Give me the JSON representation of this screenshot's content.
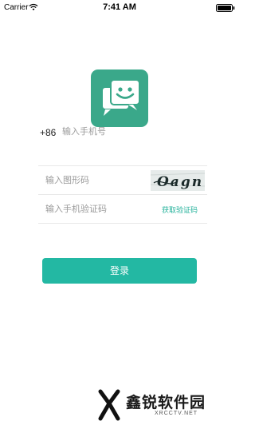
{
  "status_bar": {
    "carrier": "Carrier",
    "time": "7:41 AM",
    "icons": [
      "wifi-icon",
      "battery-icon"
    ]
  },
  "logo": {
    "icon": "chat-smile-icon",
    "color": "#3aa88a"
  },
  "form": {
    "country_code": "+86",
    "phone_placeholder": "输入手机号",
    "captcha_placeholder": "输入图形码",
    "captcha_text": "Oagn",
    "sms_placeholder": "输入手机验证码",
    "sms_link": "获取验证码"
  },
  "login_button": {
    "label": "登录",
    "color": "#23b8a3"
  },
  "watermark": {
    "text": "鑫锐软件园",
    "sub": "XRCCTV.NET"
  },
  "colors": {
    "accent": "#23b8a3",
    "link": "#23b19a",
    "divider": "#e8e8e8"
  }
}
